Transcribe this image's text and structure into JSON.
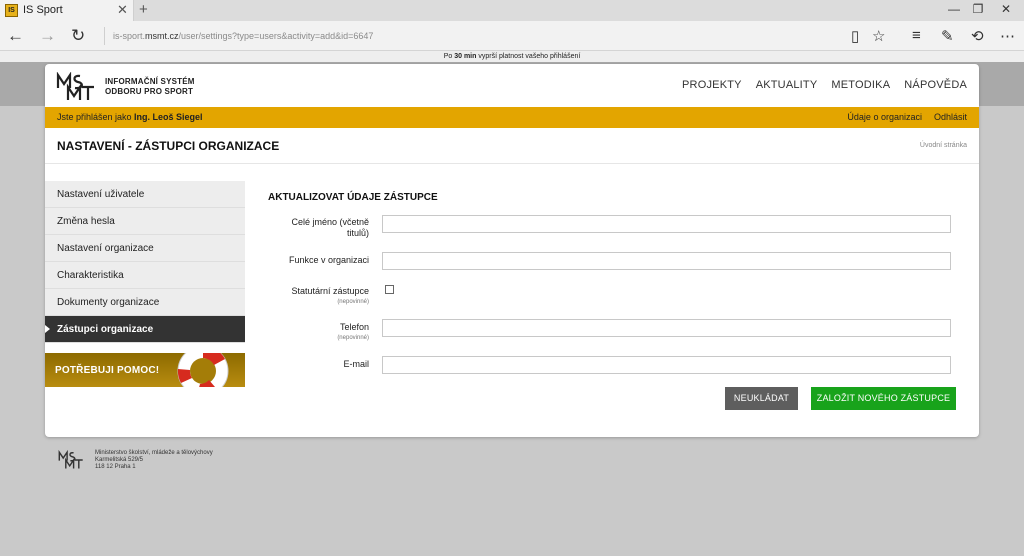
{
  "browser": {
    "tab_title": "IS Sport",
    "tab_favicon_text": "IS",
    "url_prefix": "is-sport.",
    "url_domain": "msmt.cz",
    "url_rest": "/user/settings?type=users&activity=add&id=6647"
  },
  "notice": {
    "pre": "Po ",
    "bold": "30 min",
    "post": " vyprší platnost vašeho přihlášení"
  },
  "header": {
    "logo_line1": "INFORMAČNÍ SYSTÉM",
    "logo_line2": "ODBORU PRO SPORT",
    "nav": [
      "PROJEKTY",
      "AKTUALITY",
      "METODIKA",
      "NÁPOVĚDA"
    ]
  },
  "userbar": {
    "prefix": "Jste přihlášen jako ",
    "user": "Ing. Leoš Siegel",
    "links": [
      "Údaje o organizaci",
      "Odhlásit"
    ]
  },
  "page": {
    "title": "NASTAVENÍ - ZÁSTUPCI ORGANIZACE",
    "breadcrumb": "Úvodní stránka"
  },
  "sidebar": {
    "items": [
      {
        "label": "Nastavení uživatele",
        "active": false
      },
      {
        "label": "Změna hesla",
        "active": false
      },
      {
        "label": "Nastavení organizace",
        "active": false
      },
      {
        "label": "Charakteristika",
        "active": false
      },
      {
        "label": "Dokumenty organizace",
        "active": false
      },
      {
        "label": "Zástupci organizace",
        "active": true
      }
    ],
    "help_banner": "POTŘEBUJI POMOC!"
  },
  "form": {
    "title": "AKTUALIZOVAT ÚDAJE ZÁSTUPCE",
    "fields": {
      "name": {
        "label_line1": "Celé jméno (včetně",
        "label_line2": "titulů)",
        "value": ""
      },
      "function": {
        "label": "Funkce v organizaci",
        "value": ""
      },
      "statutory": {
        "label": "Statutární zástupce",
        "hint": "(nepovinné)",
        "checked": false
      },
      "phone": {
        "label": "Telefon",
        "hint": "(nepovinné)",
        "value": ""
      },
      "email": {
        "label": "E-mail",
        "value": ""
      }
    },
    "buttons": {
      "cancel": "NEUKLÁDAT",
      "submit": "ZALOŽIT NOVÉHO ZÁSTUPCE"
    }
  },
  "footer": {
    "line1": "Ministerstvo školství, mládeže a tělovýchovy",
    "line2": "Karmelitská 529/5",
    "line3": "118 12 Praha 1"
  },
  "colors": {
    "accent": "#e3a500",
    "submit": "#18a31b",
    "cancel": "#5e5e5e",
    "active_nav": "#333333"
  }
}
